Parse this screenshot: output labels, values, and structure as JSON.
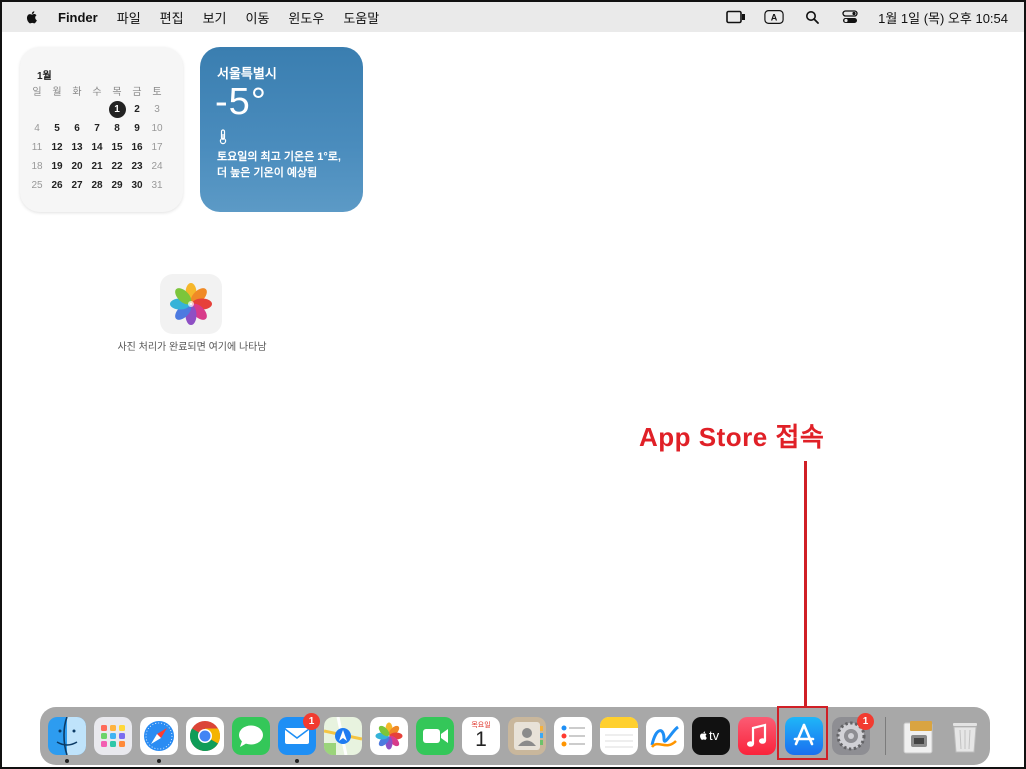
{
  "menubar": {
    "app_name": "Finder",
    "items": [
      "파일",
      "편집",
      "보기",
      "이동",
      "윈도우",
      "도움말"
    ],
    "input_indicator": "A",
    "clock": "1월 1일 (목) 오후 10:54"
  },
  "calendar": {
    "month": "1월",
    "weekdays": [
      "일",
      "월",
      "화",
      "수",
      "목",
      "금",
      "토"
    ],
    "weeks": [
      [
        "",
        "",
        "",
        "",
        "1",
        "2",
        "3"
      ],
      [
        "4",
        "5",
        "6",
        "7",
        "8",
        "9",
        "10"
      ],
      [
        "11",
        "12",
        "13",
        "14",
        "15",
        "16",
        "17"
      ],
      [
        "18",
        "19",
        "20",
        "21",
        "22",
        "23",
        "24"
      ],
      [
        "25",
        "26",
        "27",
        "28",
        "29",
        "30",
        "31"
      ]
    ],
    "today": "1"
  },
  "weather": {
    "city": "서울특별시",
    "temperature": "-5°",
    "forecast": "토요일의 최고 기온은 1°로, 더 높은 기온이 예상됨"
  },
  "photos_widget": {
    "message": "사진 처리가 완료되면 여기에 나타남"
  },
  "annotation": {
    "label": "App Store 접속",
    "color": "#e02027"
  },
  "dock": {
    "apps": [
      {
        "name": "Finder",
        "icon": "finder-icon",
        "running": true
      },
      {
        "name": "Launchpad",
        "icon": "launchpad-icon",
        "running": false
      },
      {
        "name": "Safari",
        "icon": "safari-icon",
        "running": true
      },
      {
        "name": "Chrome",
        "icon": "chrome-icon",
        "running": false
      },
      {
        "name": "Messages",
        "icon": "messages-icon",
        "running": false
      },
      {
        "name": "Mail",
        "icon": "mail-icon",
        "running": true,
        "badge": "1"
      },
      {
        "name": "Maps",
        "icon": "maps-icon",
        "running": false
      },
      {
        "name": "Photos",
        "icon": "photos-icon",
        "running": false
      },
      {
        "name": "FaceTime",
        "icon": "facetime-icon",
        "running": false
      },
      {
        "name": "Calendar",
        "icon": "calendar-icon",
        "running": false,
        "label_top": "목요일",
        "label_day": "1"
      },
      {
        "name": "Contacts",
        "icon": "contacts-icon",
        "running": false
      },
      {
        "name": "Reminders",
        "icon": "reminders-icon",
        "running": false
      },
      {
        "name": "Notes",
        "icon": "notes-icon",
        "running": false
      },
      {
        "name": "Freeform",
        "icon": "freeform-icon",
        "running": false
      },
      {
        "name": "TV",
        "icon": "tv-icon",
        "running": false,
        "label": "tv"
      },
      {
        "name": "Music",
        "icon": "music-icon",
        "running": false
      },
      {
        "name": "App Store",
        "icon": "app-store-icon",
        "running": false
      },
      {
        "name": "System Settings",
        "icon": "system-settings-icon",
        "running": false,
        "badge": "1"
      },
      {
        "name": "Downloads",
        "icon": "downloads-stack-icon",
        "running": false
      },
      {
        "name": "Trash",
        "icon": "trash-icon",
        "running": false
      }
    ]
  }
}
